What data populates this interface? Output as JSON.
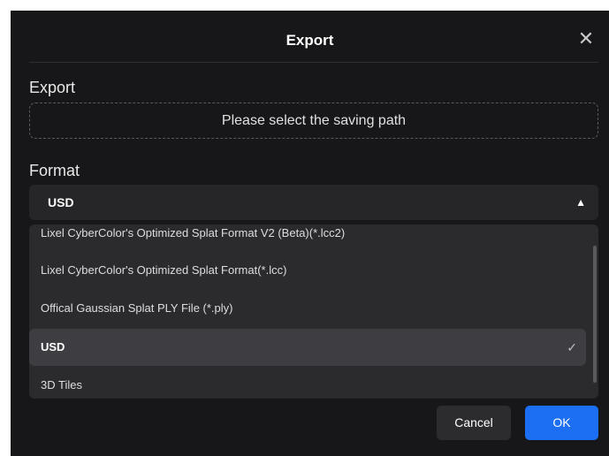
{
  "dialog": {
    "title": "Export",
    "close_icon": "close-icon"
  },
  "export_section": {
    "label": "Export",
    "path_placeholder": "Please select the saving path"
  },
  "format_section": {
    "label": "Format",
    "selected_value": "USD",
    "options": [
      {
        "label": "Lixel CyberColor's Optimized Splat Format V2 (Beta)(*.lcc2)"
      },
      {
        "label": "Lixel CyberColor's Optimized Splat Format(*.lcc)"
      },
      {
        "label": "Offical Gaussian Splat PLY File (*.ply)"
      },
      {
        "label": "USD",
        "selected": true
      },
      {
        "label": "3D Tiles"
      }
    ]
  },
  "buttons": {
    "cancel": "Cancel",
    "ok": "OK"
  },
  "colors": {
    "background": "#171719",
    "accent": "#1c6ef2"
  }
}
